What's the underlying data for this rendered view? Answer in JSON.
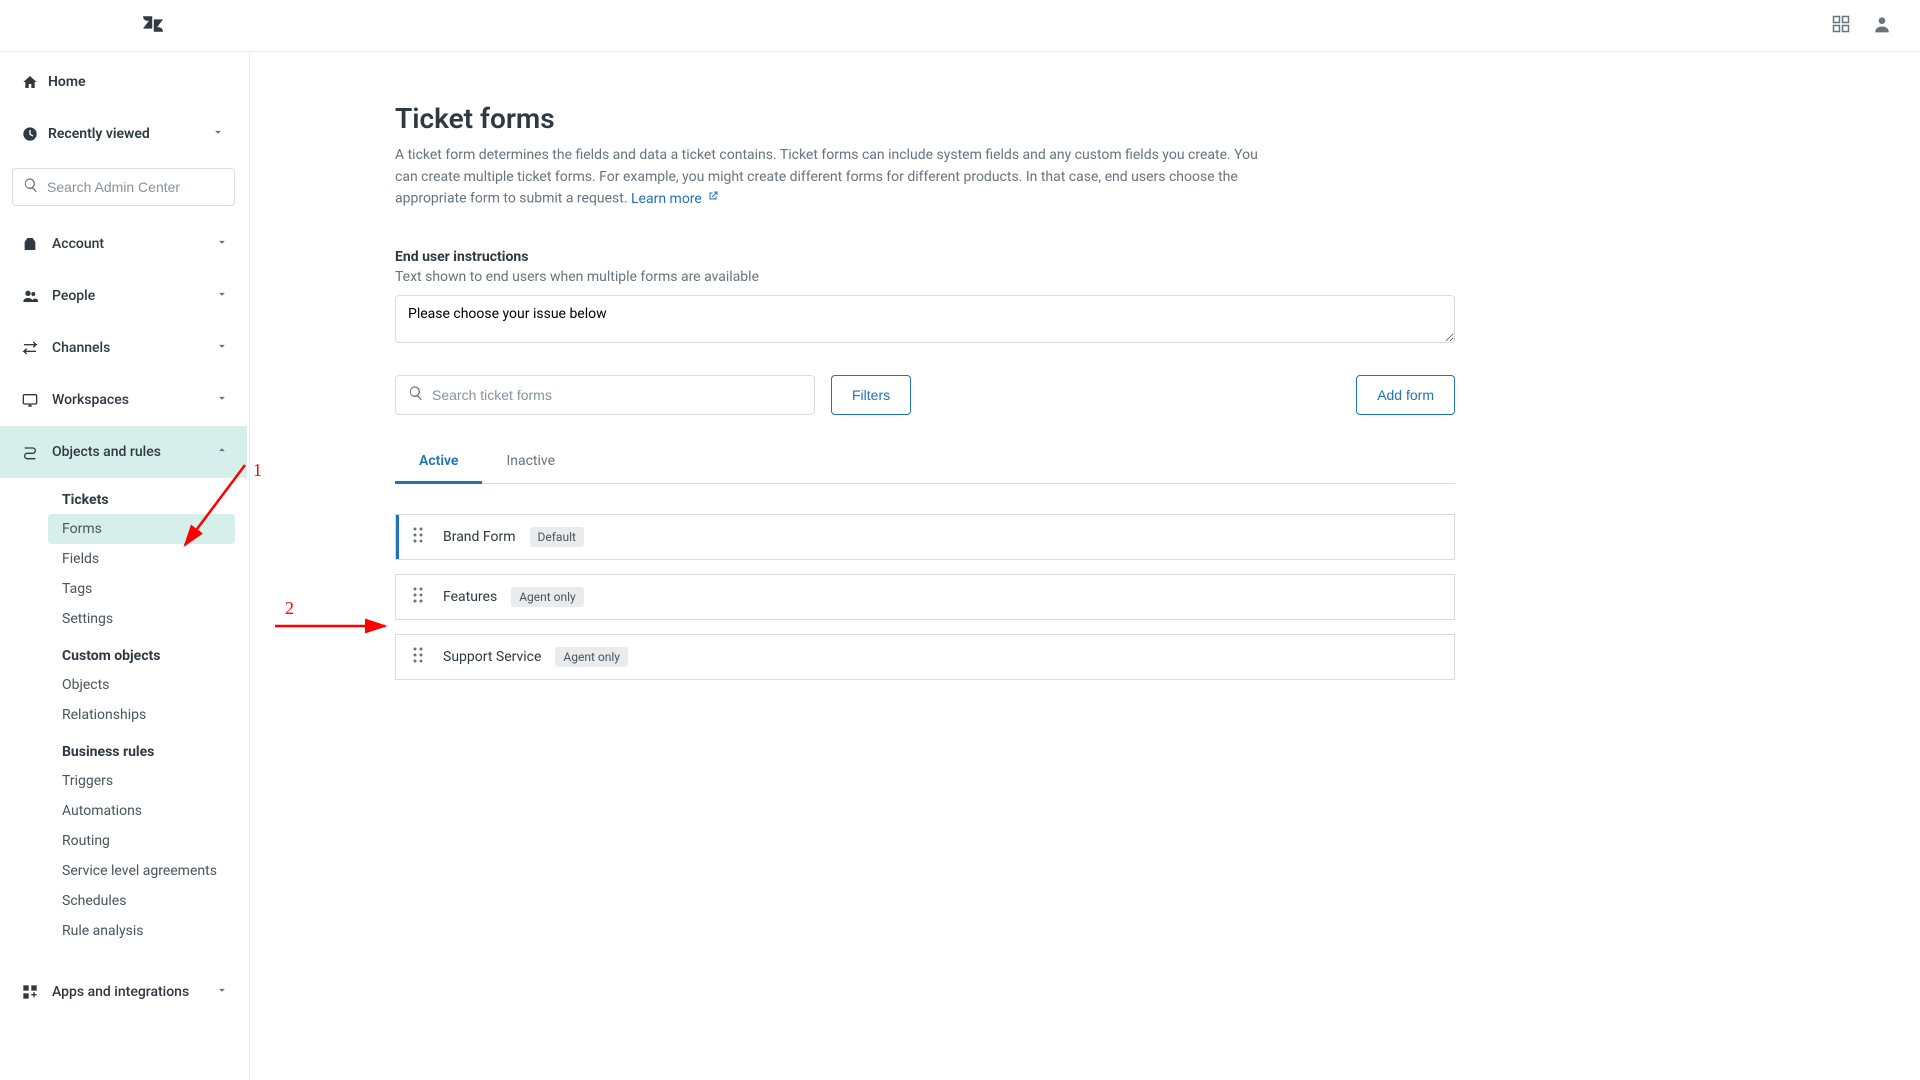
{
  "topbar": {
    "apps_icon": "apps",
    "profile_icon": "profile"
  },
  "sidebar": {
    "home": "Home",
    "recently_viewed": "Recently viewed",
    "search_placeholder": "Search Admin Center",
    "categories": {
      "account": "Account",
      "people": "People",
      "channels": "Channels",
      "workspaces": "Workspaces",
      "objects": "Objects and rules",
      "apps": "Apps and integrations"
    },
    "groups": {
      "tickets": "Tickets",
      "custom_objects": "Custom objects",
      "business_rules": "Business rules"
    },
    "links": {
      "forms": "Forms",
      "fields": "Fields",
      "tags": "Tags",
      "settings": "Settings",
      "objects": "Objects",
      "relationships": "Relationships",
      "triggers": "Triggers",
      "automations": "Automations",
      "routing": "Routing",
      "sla": "Service level agreements",
      "schedules": "Schedules",
      "rule_analysis": "Rule analysis"
    }
  },
  "page": {
    "title": "Ticket forms",
    "description": "A ticket form determines the fields and data a ticket contains. Ticket forms can include system fields and any custom fields you create. You can create multiple ticket forms. For example, you might create different forms for different products. In that case, end users choose the appropriate form to submit a request. ",
    "learn_more": "Learn more",
    "instructions_label": "End user instructions",
    "instructions_help": "Text shown to end users when multiple forms are available",
    "instructions_value": "Please choose your issue below",
    "search_forms_placeholder": "Search ticket forms",
    "filters_btn": "Filters",
    "add_btn": "Add form",
    "tabs": {
      "active": "Active",
      "inactive": "Inactive"
    },
    "forms": [
      {
        "name": "Brand Form",
        "badge": "Default",
        "accent": true
      },
      {
        "name": "Features",
        "badge": "Agent only",
        "accent": false
      },
      {
        "name": "Support Service",
        "badge": "Agent only",
        "accent": false
      }
    ]
  },
  "annotations": {
    "n1": "1",
    "n2": "2"
  }
}
